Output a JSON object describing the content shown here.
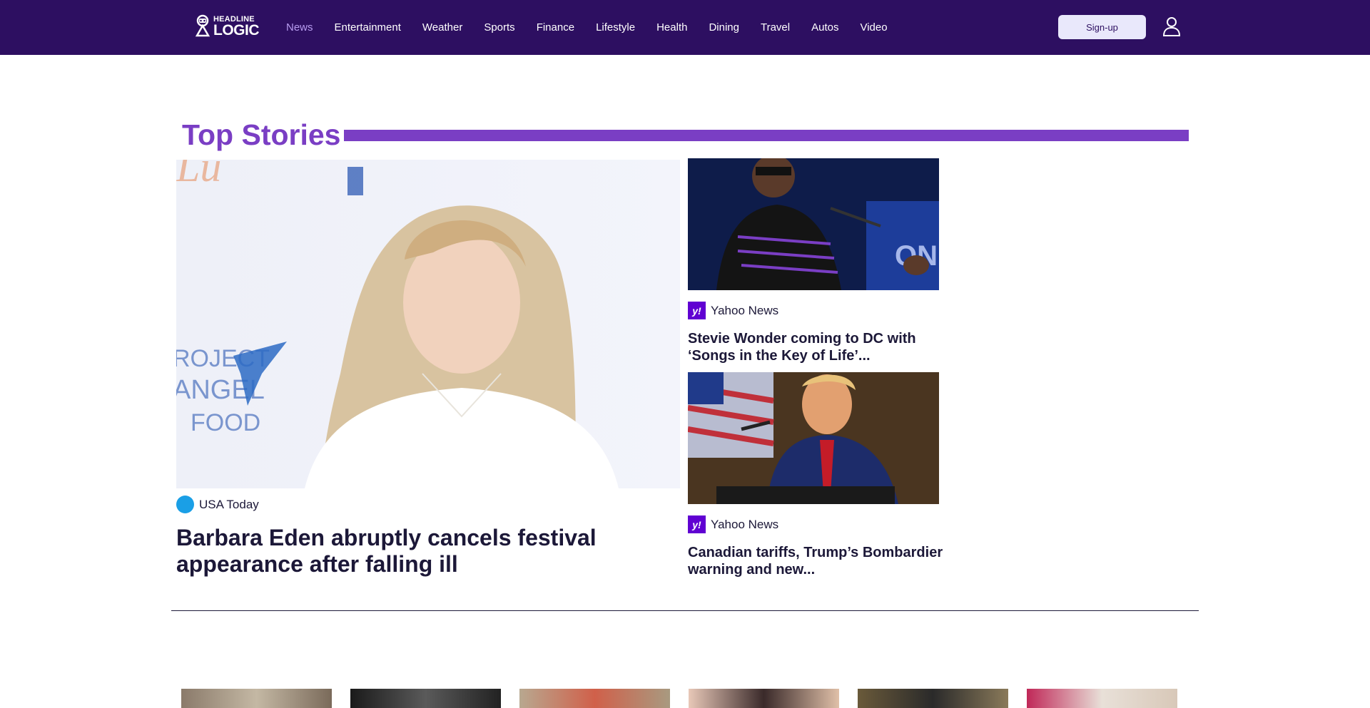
{
  "header": {
    "logo": {
      "line1": "HEADLINE",
      "line2": "LOGIC",
      "icon": "robot-logo-icon"
    },
    "nav": [
      {
        "label": "News",
        "active": true
      },
      {
        "label": "Entertainment"
      },
      {
        "label": "Weather"
      },
      {
        "label": "Sports"
      },
      {
        "label": "Finance"
      },
      {
        "label": "Lifestyle"
      },
      {
        "label": "Health"
      },
      {
        "label": "Dining"
      },
      {
        "label": "Travel"
      },
      {
        "label": "Autos"
      },
      {
        "label": "Video"
      }
    ],
    "signup_label": "Sign-up",
    "user_icon": "user-icon"
  },
  "section": {
    "title": "Top Stories"
  },
  "hero": {
    "source": "USA Today",
    "headline": "Barbara Eden abruptly cancels festival appearance after falling ill"
  },
  "side_stories": [
    {
      "source": "Yahoo News",
      "headline": "Stevie Wonder coming to DC with ‘Songs in the Key of Life’..."
    },
    {
      "source": "Yahoo News",
      "headline": "Canadian tariffs, Trump’s Bombardier warning and new..."
    }
  ],
  "colors": {
    "header_bg": "#2d0f61",
    "accent": "#7a3ec4",
    "active_nav": "#b79cf0",
    "yahoo": "#6001d2",
    "usa_today": "#1a9fe6"
  }
}
